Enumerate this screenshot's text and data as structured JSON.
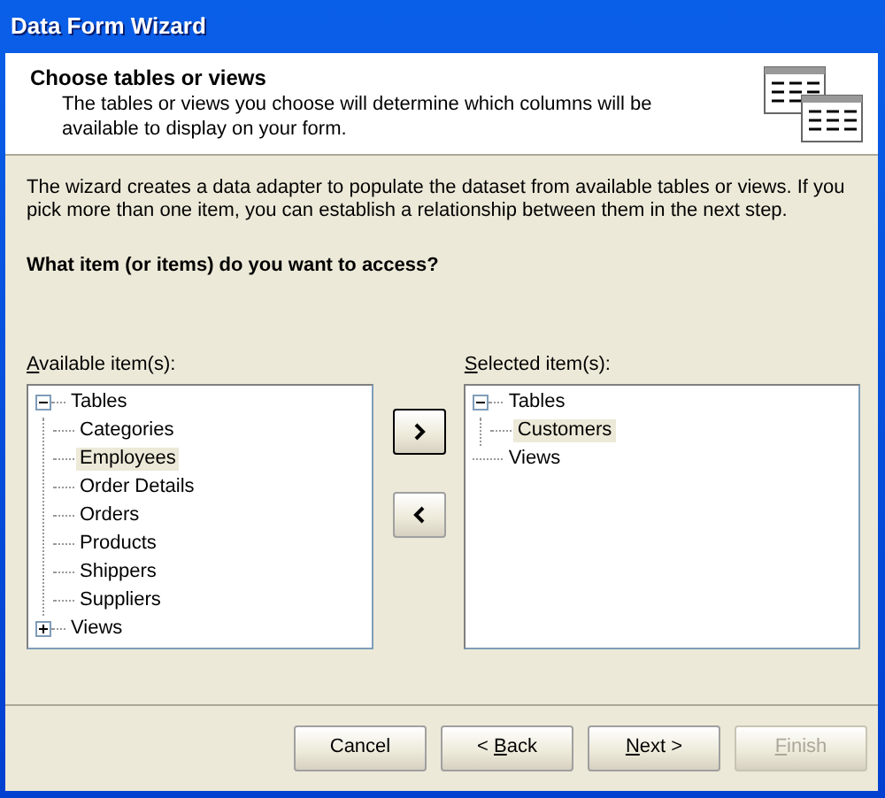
{
  "window": {
    "title": "Data Form Wizard"
  },
  "header": {
    "title": "Choose tables or views",
    "subtitle": "The tables or views you choose will determine which columns will be available to display on your form."
  },
  "description": "The wizard creates a data adapter to populate the dataset from available tables or views. If you pick more than one item, you can establish a relationship between them in the next step.",
  "question": "What item (or items) do you want to access?",
  "available": {
    "access_key": "A",
    "label_after": "vailable item(s):",
    "tree": [
      {
        "label": "Tables",
        "kind": "folder",
        "expanded": true,
        "selected": false,
        "children": [
          {
            "label": "Categories",
            "kind": "leaf",
            "selected": false
          },
          {
            "label": "Employees",
            "kind": "leaf",
            "selected": true
          },
          {
            "label": "Order Details",
            "kind": "leaf",
            "selected": false
          },
          {
            "label": "Orders",
            "kind": "leaf",
            "selected": false
          },
          {
            "label": "Products",
            "kind": "leaf",
            "selected": false
          },
          {
            "label": "Shippers",
            "kind": "leaf",
            "selected": false
          },
          {
            "label": "Suppliers",
            "kind": "leaf",
            "selected": false
          }
        ]
      },
      {
        "label": "Views",
        "kind": "folder",
        "expanded": false,
        "selected": false
      }
    ]
  },
  "move_buttons": [
    {
      "kind": "add",
      "default": true
    },
    {
      "kind": "remove",
      "default": false
    }
  ],
  "selected_items": {
    "access_key": "S",
    "label_after": "elected item(s):",
    "tree": [
      {
        "label": "Tables",
        "kind": "folder",
        "expanded": true,
        "selected": false,
        "children": [
          {
            "label": "Customers",
            "kind": "leaf",
            "selected": true
          }
        ]
      },
      {
        "label": "Views",
        "kind": "leaf",
        "selected": false
      }
    ]
  },
  "buttons": [
    {
      "label_before": "Cancel",
      "disabled": false
    },
    {
      "label_before": "< ",
      "access_key": "B",
      "label_after": "ack",
      "disabled": false
    },
    {
      "access_key": "N",
      "label_after": "ext >",
      "disabled": false
    },
    {
      "access_key": "F",
      "label_after": "inish",
      "disabled": true
    }
  ]
}
